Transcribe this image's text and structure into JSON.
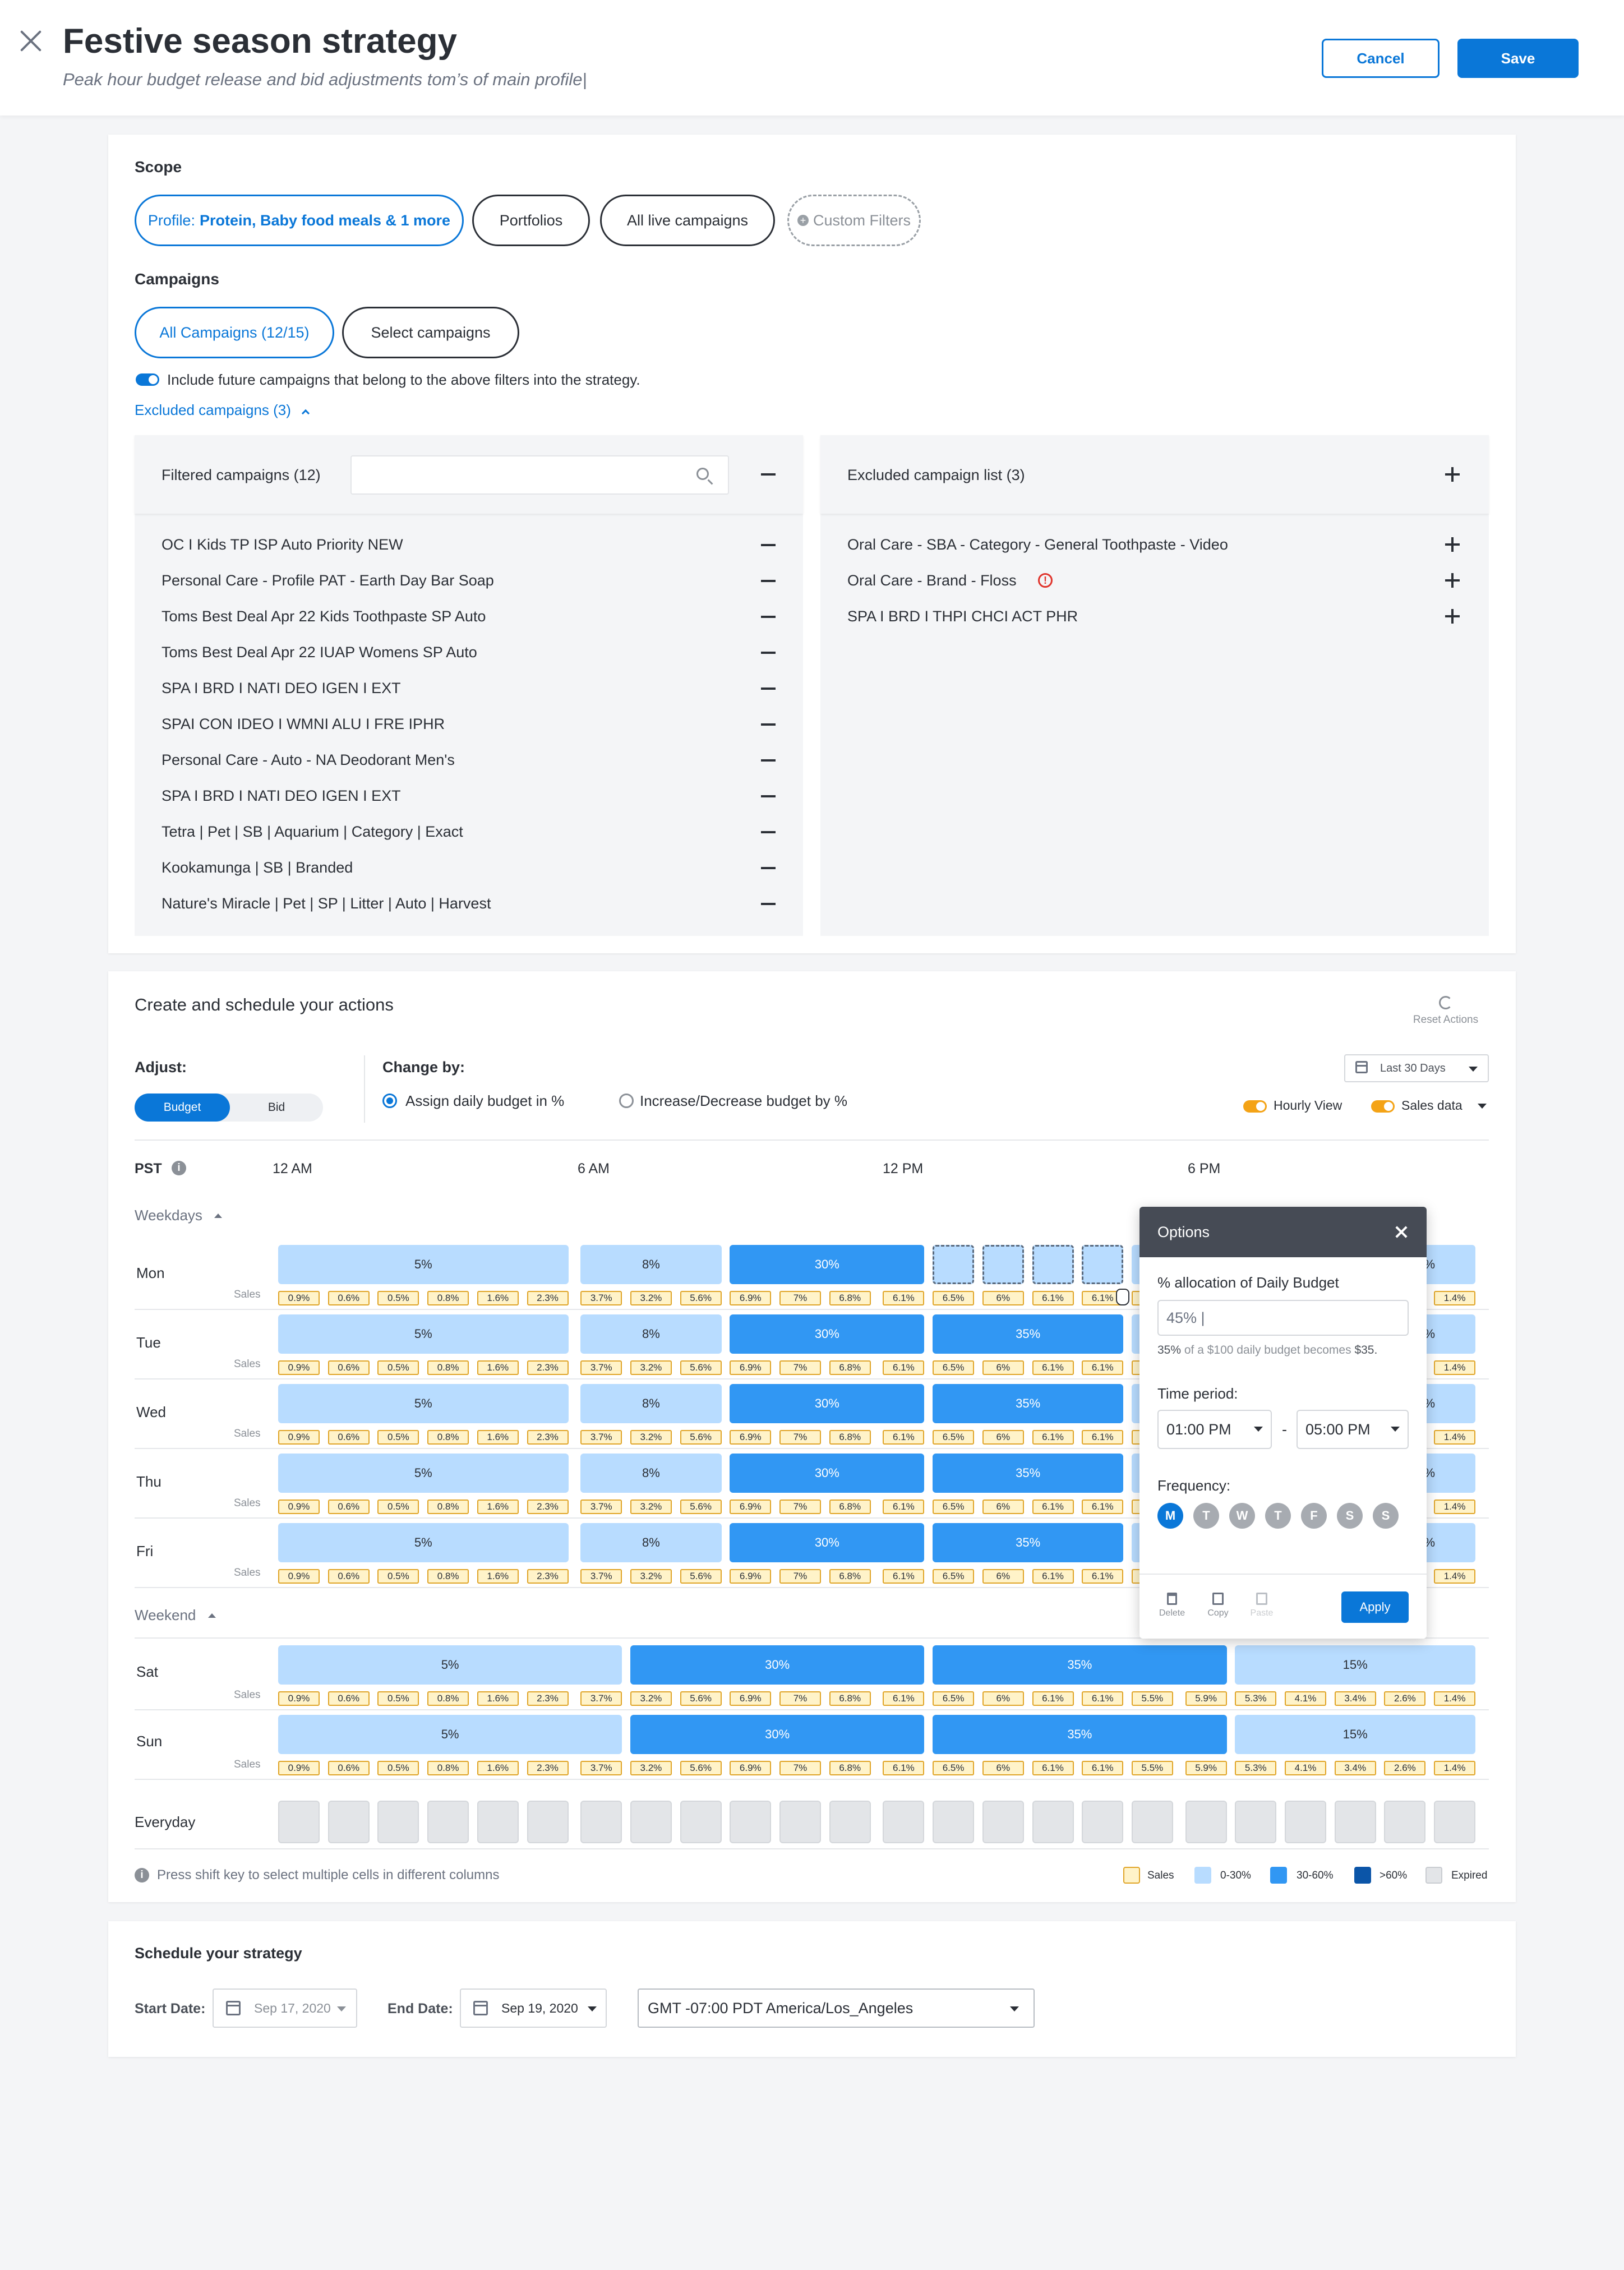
{
  "header": {
    "title": "Festive season strategy",
    "subtitle": "Peak hour budget release and bid adjustments tom’s of main profile|",
    "cancel": "Cancel",
    "save": "Save"
  },
  "scope": {
    "label": "Scope",
    "profile_prefix": "Profile:",
    "profile_value": "Protein, Baby food meals & 1 more",
    "portfolios": "Portfolios",
    "all_live": "All live campaigns",
    "custom_filters": "Custom Filters"
  },
  "campaigns": {
    "label": "Campaigns",
    "all": "All Campaigns (12/15)",
    "select": "Select campaigns",
    "include_text": "Include future campaigns that belong to the above filters into the strategy.",
    "excluded_toggle": "Excluded campaigns (3)"
  },
  "filtered": {
    "title": "Filtered campaigns (12)",
    "search_placeholder": "",
    "items": [
      "OC I Kids TP ISP Auto Priority NEW",
      "Personal Care - Profile PAT - Earth Day Bar Soap",
      "Toms Best Deal Apr 22 Kids Toothpaste SP Auto",
      "Toms Best Deal Apr 22 IUAP Womens SP Auto",
      "SPA I BRD I NATI DEO IGEN I EXT",
      "SPAI CON IDEO I WMNI ALU I FRE IPHR",
      "Personal Care - Auto - NA Deodorant Men's",
      "SPA I BRD I NATI DEO IGEN I EXT",
      "Tetra | Pet | SB | Aquarium | Category | Exact",
      "Kookamunga | SB | Branded",
      "Nature's Miracle | Pet | SP | Litter | Auto | Harvest"
    ]
  },
  "excluded": {
    "title": "Excluded campaign list (3)",
    "items": [
      "Oral Care - SBA - Category - General Toothpaste - Video",
      "Oral Care - Brand - Floss",
      "SPA I BRD I THPI CHCI ACT PHR"
    ]
  },
  "actions": {
    "title": "Create and schedule your actions",
    "reset": "Reset Actions",
    "adjust_label": "Adjust:",
    "adjust_budget": "Budget",
    "adjust_bid": "Bid",
    "changeby_label": "Change by:",
    "opt_assign": "Assign daily budget in %",
    "opt_incdec": "Increase/Decrease budget by %",
    "date_range": "Last 30 Days",
    "hourly_view": "Hourly View",
    "sales_data": "Sales data",
    "tz": "PST",
    "time_labels": [
      "12 AM",
      "6 AM",
      "12 PM",
      "6 PM"
    ],
    "weekdays_label": "Weekdays",
    "weekend_label": "Weekend",
    "everyday_label": "Everyday",
    "sales_label": "Sales",
    "days": {
      "mon": "Mon",
      "tue": "Tue",
      "wed": "Wed",
      "thu": "Thu",
      "fri": "Fri",
      "sat": "Sat",
      "sun": "Sun"
    },
    "wd_blocks": [
      "5%",
      "8%",
      "30%",
      "35%",
      "0%"
    ],
    "we_blocks": [
      "5%",
      "30%",
      "35%",
      "15%"
    ],
    "sales": [
      "0.9%",
      "0.6%",
      "0.5%",
      "0.8%",
      "1.6%",
      "2.3%",
      "3.7%",
      "3.2%",
      "5.6%",
      "6.9%",
      "7%",
      "6.8%",
      "6.1%",
      "6.5%",
      "6%",
      "6.1%",
      "6.1%",
      "5.5%",
      "5.9%",
      "5.3%",
      "4.1%",
      "3.4%",
      "2.6%",
      "1.4%"
    ],
    "hint": "Press shift key to select multiple cells in different columns",
    "legend": [
      "Sales",
      "0-30%",
      "30-60%",
      ">60%",
      "Expired"
    ]
  },
  "popover": {
    "title": "Options",
    "alloc_label": "% allocation of Daily Budget",
    "alloc_value": "45% |",
    "alloc_hint_pct": "35%",
    "alloc_hint_mid": "of a $100 daily budget becomes",
    "alloc_hint_amt": "$35.",
    "time_label": "Time period:",
    "time_from": "01:00 PM",
    "time_sep": "-",
    "time_to": "05:00 PM",
    "freq_label": "Frequency:",
    "days": [
      "M",
      "T",
      "W",
      "T",
      "F",
      "S",
      "S"
    ],
    "delete": "Delete",
    "copy": "Copy",
    "paste": "Paste",
    "apply": "Apply"
  },
  "schedule": {
    "title": "Schedule your strategy",
    "start_label": "Start Date:",
    "start_value": "Sep 17, 2020",
    "end_label": "End Date:",
    "end_value": "Sep 19, 2020",
    "timezone": "GMT -07:00 PDT America/Los_Angeles"
  },
  "colors": {
    "accent": "#0a77d8",
    "light": "#b8dcff",
    "mid": "#3197f3",
    "dark": "#0b55a8",
    "sales": "#fff3c9",
    "expired": "#e3e5e8",
    "toggle_orange": "#f4a316"
  }
}
